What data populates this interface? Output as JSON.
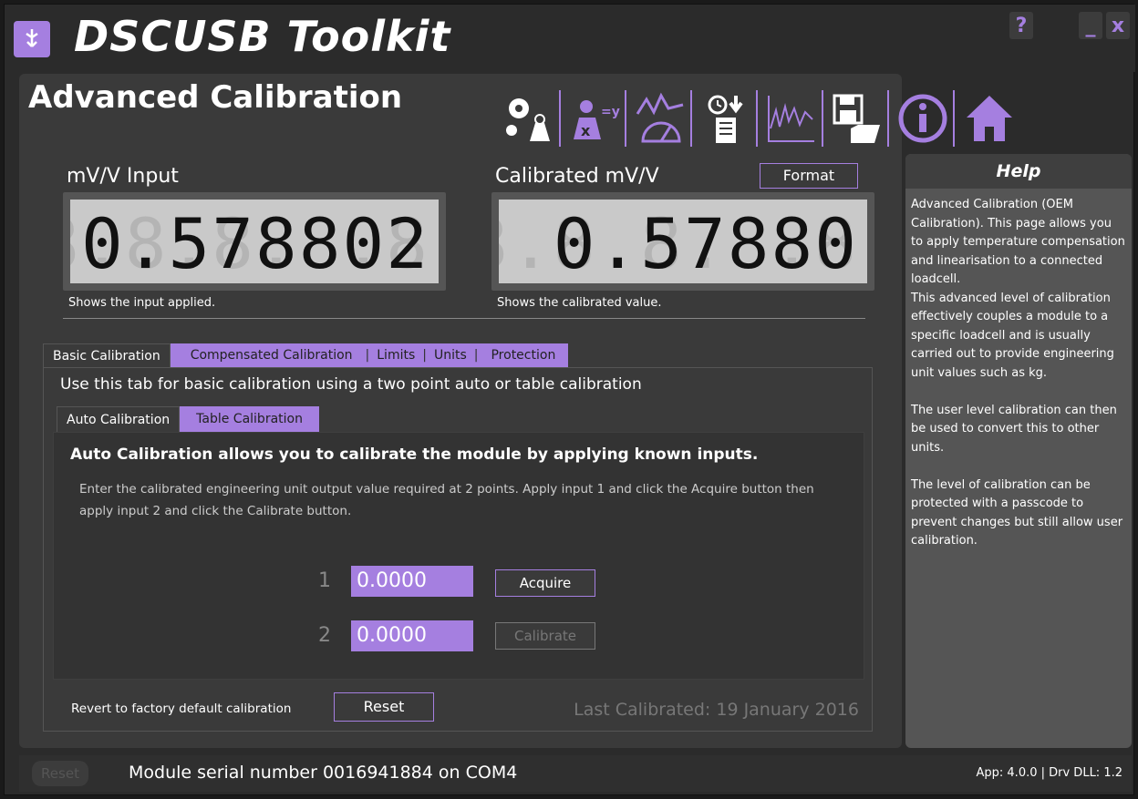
{
  "app": {
    "title": "DSCUSB Toolkit",
    "help_btn": "?",
    "minimize_btn": "_",
    "close_btn": "x"
  },
  "page": {
    "title": "Advanced Calibration"
  },
  "toolbar": {
    "icons": [
      "gear-weight-icon",
      "x-equals-y-icon",
      "gauge-icon",
      "timer-log-icon",
      "chart-icon",
      "save-folder-icon",
      "info-icon",
      "home-icon"
    ]
  },
  "input_display": {
    "label": "mV/V Input",
    "ghost": "8.8.8.8.8.8.8",
    "value": "0.578802",
    "caption": "Shows the input applied."
  },
  "calibrated_display": {
    "label": "Calibrated mV/V",
    "format_button": "Format",
    "ghost": "8.8.8.8.8.8.8",
    "value": "0.57880",
    "caption": "Shows the calibrated value."
  },
  "tabs": [
    "Basic Calibration",
    "Compensated Calibration",
    "Limits",
    "Units",
    "Protection"
  ],
  "basic": {
    "description": "Use this tab for basic calibration using a two point auto or table calibration",
    "subtabs": [
      "Auto Calibration",
      "Table Calibration"
    ],
    "auto": {
      "heading": "Auto Calibration allows you to calibrate the module by applying known inputs.",
      "description": "Enter the calibrated engineering unit output value required at 2 points. Apply input 1 and click the Acquire button then apply input 2 and click the Calibrate button.",
      "point1": {
        "num": "1",
        "value": "0.0000",
        "button": "Acquire"
      },
      "point2": {
        "num": "2",
        "value": "0.0000",
        "button": "Calibrate"
      }
    },
    "revert_label": "Revert to factory default calibration",
    "reset_button": "Reset",
    "last_calibrated": "Last Calibrated: 19 January 2016"
  },
  "help": {
    "title": "Help",
    "text": "Advanced Calibration (OEM Calibration). This page allows you to apply temperature compensation and linearisation to a connected loadcell.\nThis advanced level of calibration effectively couples a module to a specific loadcell and is usually carried out to provide engineering unit values such as kg.\n\nThe user level calibration can then be used to convert this to other units.\n\nThe level of calibration can be protected with a passcode to prevent changes but still allow user calibration."
  },
  "status": {
    "reset": "Reset",
    "serial": "Module serial number 0016941884 on COM4",
    "version": "App: 4.0.0 | Drv DLL: 1.2"
  },
  "colors": {
    "accent": "#a57fe0",
    "background": "#2b2b2b",
    "panel": "#3a3a3a"
  }
}
